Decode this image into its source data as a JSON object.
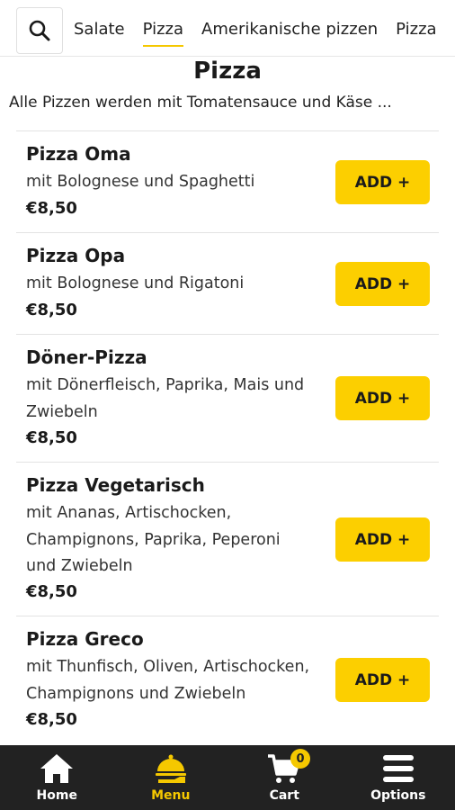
{
  "categories": {
    "tabs": [
      "Salate",
      "Pizza",
      "Amerikanische pizzen",
      "Pizza"
    ],
    "active": "Pizza"
  },
  "section": {
    "title": "Pizza",
    "description": "Alle Pizzen werden mit Tomatensauce und Käse ..."
  },
  "items": [
    {
      "name": "Pizza Oma",
      "desc": [
        "mit Bolognese und Spaghetti"
      ],
      "price": "€8,50",
      "button": "ADD +"
    },
    {
      "name": "Pizza Opa",
      "desc": [
        "mit Bolognese und Rigatoni"
      ],
      "price": "€8,50",
      "button": "ADD +"
    },
    {
      "name": "Döner-Pizza",
      "desc": [
        "mit Dönerfleisch, Paprika, Mais und",
        "Zwiebeln"
      ],
      "price": "€8,50",
      "button": "ADD +"
    },
    {
      "name": "Pizza Vegetarisch",
      "desc": [
        "mit Ananas, Artischocken,",
        "Champignons, Paprika, Peperoni",
        "und Zwiebeln"
      ],
      "price": "€8,50",
      "button": "ADD +"
    },
    {
      "name": "Pizza Greco",
      "desc": [
        "mit Thunfisch, Oliven, Artischocken,",
        "Champignons und Zwiebeln"
      ],
      "price": "€8,50",
      "button": "ADD +"
    }
  ],
  "bottom_nav": {
    "home": "Home",
    "menu": "Menu",
    "cart": "Cart",
    "cart_count": "0",
    "options": "Options"
  },
  "icons": {
    "search": "search-icon",
    "home": "home-icon",
    "menu": "food-serving-icon",
    "cart": "cart-icon",
    "options": "hamburger-menu-icon"
  },
  "colors": {
    "accent": "#fccf00",
    "bottom_bar": "#222222"
  }
}
